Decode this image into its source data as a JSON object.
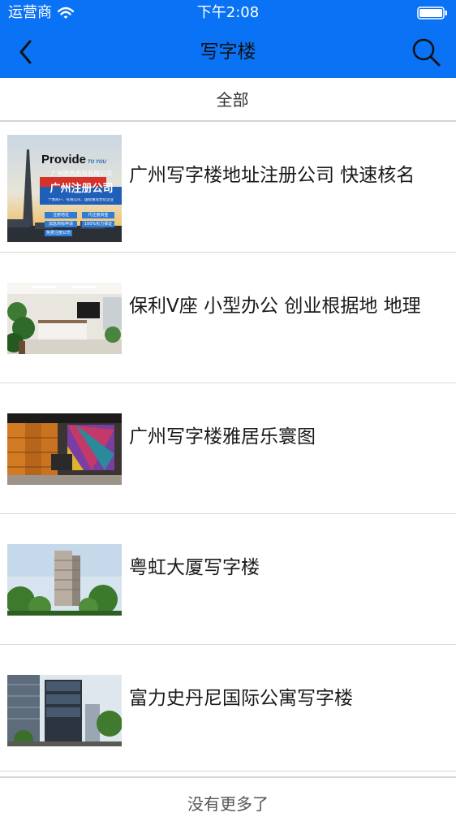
{
  "status_bar": {
    "carrier": "运营商",
    "time": "下午2:08"
  },
  "header": {
    "title": "写字楼",
    "back_icon": "chevron-left-icon",
    "search_icon": "search-icon"
  },
  "filter": {
    "label": "全部"
  },
  "listings": [
    {
      "title": "广州写字楼地址注册公司 快速核名",
      "thumb": {
        "heading": "Provide",
        "heading_small": "TO YOU",
        "company": "广州欧西商务有限公司",
        "big": "广州注册公司",
        "tagline": "个体商户、有限公司、国际独资合伙企业",
        "tags": [
          "注册地址",
          "代注册资金",
          "加急商标申请",
          "100%实力保证",
          "免费注册公司"
        ]
      }
    },
    {
      "title": "保利V座 小型办公 创业根据地 地理"
    },
    {
      "title": "广州写字楼雅居乐寰图"
    },
    {
      "title": "粤虹大厦写字楼"
    },
    {
      "title": "富力史丹尼国际公寓写字楼"
    }
  ],
  "footer": {
    "text": "没有更多了"
  },
  "colors": {
    "header_bg": "#0a72f5",
    "divider": "#d4d4d4"
  }
}
